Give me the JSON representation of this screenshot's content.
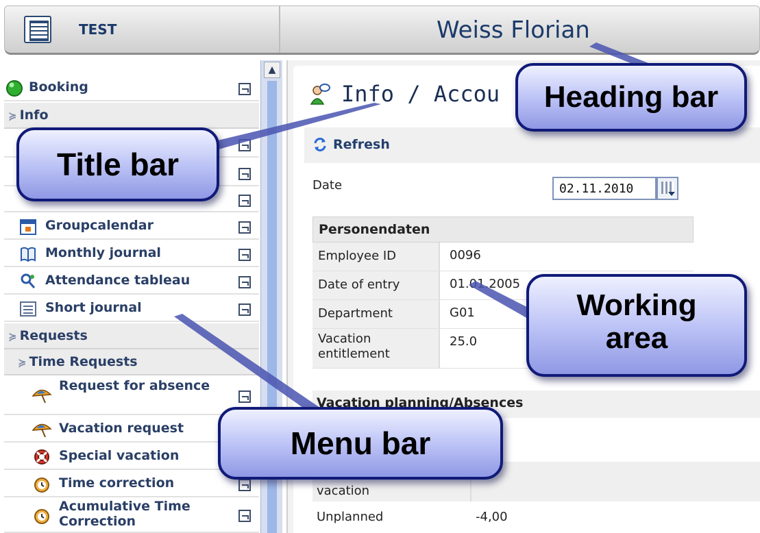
{
  "header": {
    "app_label": "TEST",
    "user_name": "Weiss Florian"
  },
  "sidebar": {
    "booking": "Booking",
    "info_section": "Info",
    "items": [
      {
        "label": "Groupcalendar",
        "icon": "calendar-icon"
      },
      {
        "label": "Monthly journal",
        "icon": "journal-icon"
      },
      {
        "label": "Attendance tableau",
        "icon": "attendance-icon"
      },
      {
        "label": "Short journal",
        "icon": "list-icon"
      }
    ],
    "requests_section": "Requests",
    "time_requests_section": "Time Requests",
    "requests": [
      {
        "label": "Request for absence",
        "icon": "umbrella-icon"
      },
      {
        "label": "Vacation request",
        "icon": "umbrella-icon"
      },
      {
        "label": "Special vacation",
        "icon": "lifebuoy-icon"
      },
      {
        "label": "Time correction",
        "icon": "alarm-clock-icon"
      },
      {
        "label": "Acumulative Time Correction",
        "icon": "alarm-clock-icon"
      }
    ]
  },
  "work": {
    "title": "Info / Accou",
    "refresh": "Refresh",
    "date_label": "Date",
    "date_value": "02.11.2010",
    "person_heading": "Personendaten",
    "person_rows": [
      {
        "label": "Employee ID",
        "value": "0096"
      },
      {
        "label": "Date of entry",
        "value": "01.01.2005"
      },
      {
        "label": "Department",
        "value": "G01"
      },
      {
        "label": "Vacation entitlement",
        "value": "25.0"
      }
    ],
    "vacation_heading": "Vacation planning/Absences",
    "vacation_row_label": "vacation",
    "unplanned_label": "Unplanned",
    "unplanned_value": "-4,00"
  },
  "callouts": {
    "heading_bar": "Heading bar",
    "title_bar": "Title bar",
    "working_area_line1": "Working",
    "working_area_line2": "area",
    "menu_bar": "Menu bar"
  },
  "colors": {
    "menu_text": "#2a3f66",
    "callout_border": "#101a78",
    "callout_fill": "#b9c0f5"
  }
}
